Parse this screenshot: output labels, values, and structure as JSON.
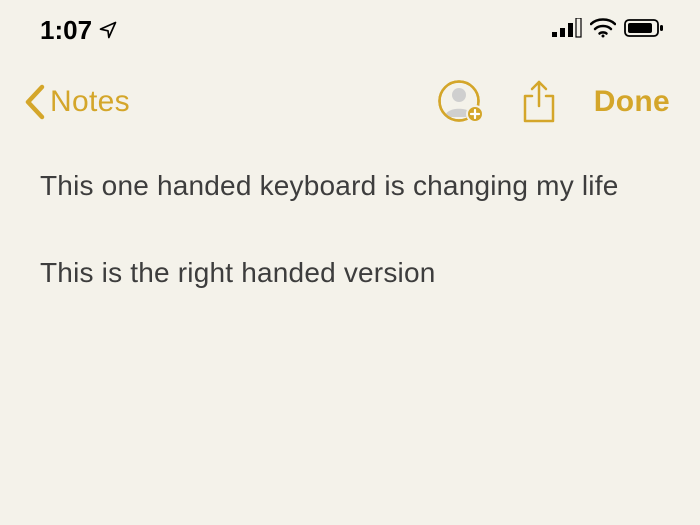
{
  "status_bar": {
    "time": "1:07"
  },
  "nav": {
    "back_label": "Notes",
    "done_label": "Done"
  },
  "note": {
    "line1": "This one handed keyboard is changing my life",
    "line2": "This is the right handed version"
  },
  "colors": {
    "accent": "#d4a62a",
    "background": "#f4f2ea",
    "text": "#3d3d3d",
    "status_text": "#000"
  }
}
